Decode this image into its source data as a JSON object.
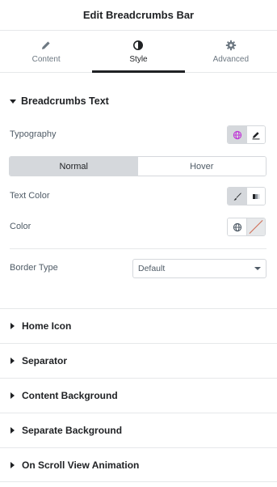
{
  "panel": {
    "title": "Edit Breadcrumbs Bar"
  },
  "tabs": [
    {
      "label": "Content",
      "icon": "pencil-icon",
      "active": false
    },
    {
      "label": "Style",
      "icon": "contrast-icon",
      "active": true
    },
    {
      "label": "Advanced",
      "icon": "gear-icon",
      "active": false
    }
  ],
  "section_open": {
    "title": "Breadcrumbs Text",
    "typography_label": "Typography",
    "state_tabs": [
      "Normal",
      "Hover"
    ],
    "state_active": "Normal",
    "text_color_label": "Text Color",
    "color_label": "Color",
    "border_type_label": "Border Type",
    "border_type_value": "Default"
  },
  "sections_closed": [
    {
      "title": "Home Icon"
    },
    {
      "title": "Separator"
    },
    {
      "title": "Content Background"
    },
    {
      "title": "Separate Background"
    },
    {
      "title": "On Scroll View Animation"
    }
  ],
  "colors": {
    "accent_globe": "#c036d7",
    "active_bg": "#d5d8dc",
    "border": "#d5d8dc",
    "clear_slash": "#d0735b"
  }
}
